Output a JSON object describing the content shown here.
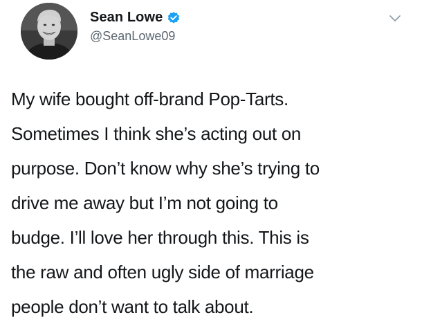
{
  "author": {
    "display_name": "Sean Lowe",
    "handle": "@SeanLowe09",
    "verified": true,
    "avatar": "profile-photo"
  },
  "tweet": {
    "lines": [
      "My wife bought off-brand Pop-Tarts.",
      "Sometimes I think she’s acting out on",
      "purpose. Don’t know why she’s trying to",
      "drive me away but I’m not going to",
      "budge. I’ll love her through this. This is",
      "the raw and often ugly side of marriage",
      "people don’t want to talk about."
    ]
  },
  "icons": {
    "verified": "verified-badge-icon",
    "menu": "chevron-down-icon"
  },
  "colors": {
    "verified_blue": "#1da1f2",
    "text": "#14171a",
    "secondary": "#5b6670"
  }
}
